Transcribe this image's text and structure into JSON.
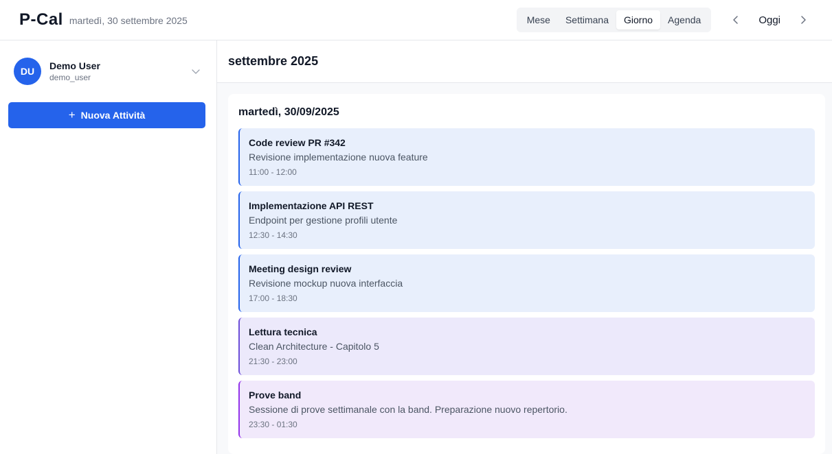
{
  "app": {
    "brand": "P-Cal",
    "today_label": "martedì, 30 settembre 2025"
  },
  "views": [
    {
      "label": "Mese",
      "active": false
    },
    {
      "label": "Settimana",
      "active": false
    },
    {
      "label": "Giorno",
      "active": true
    },
    {
      "label": "Agenda",
      "active": false
    }
  ],
  "nav": {
    "today_label": "Oggi",
    "prev_icon": "chevron-left-icon",
    "next_icon": "chevron-right-icon"
  },
  "user": {
    "initials": "DU",
    "name": "Demo User",
    "handle": "demo_user"
  },
  "sidebar": {
    "new_activity_label": "Nuova Attività"
  },
  "main": {
    "month_label": "settembre 2025",
    "day_title": "martedì, 30/09/2025"
  },
  "events": [
    {
      "title": "Code review PR #342",
      "desc": "Revisione implementazione nuova feature",
      "time": "11:00 - 12:00",
      "bg": "#e8effc",
      "accent": "#2563eb"
    },
    {
      "title": "Implementazione API REST",
      "desc": "Endpoint per gestione profili utente",
      "time": "12:30 - 14:30",
      "bg": "#e8effc",
      "accent": "#2563eb"
    },
    {
      "title": "Meeting design review",
      "desc": "Revisione mockup nuova interfaccia",
      "time": "17:00 - 18:30",
      "bg": "#e8effc",
      "accent": "#2563eb"
    },
    {
      "title": "Lettura tecnica",
      "desc": "Clean Architecture - Capitolo 5",
      "time": "21:30 - 23:00",
      "bg": "#ece9fb",
      "accent": "#6d4ed8"
    },
    {
      "title": "Prove band",
      "desc": "Sessione di prove settimanale con la band. Preparazione nuovo repertorio.",
      "time": "23:30 - 01:30",
      "bg": "#f1e9fb",
      "accent": "#9333ea"
    }
  ],
  "colors": {
    "primary": "#2563eb",
    "border": "#e5e7eb",
    "muted": "#6b7280"
  }
}
